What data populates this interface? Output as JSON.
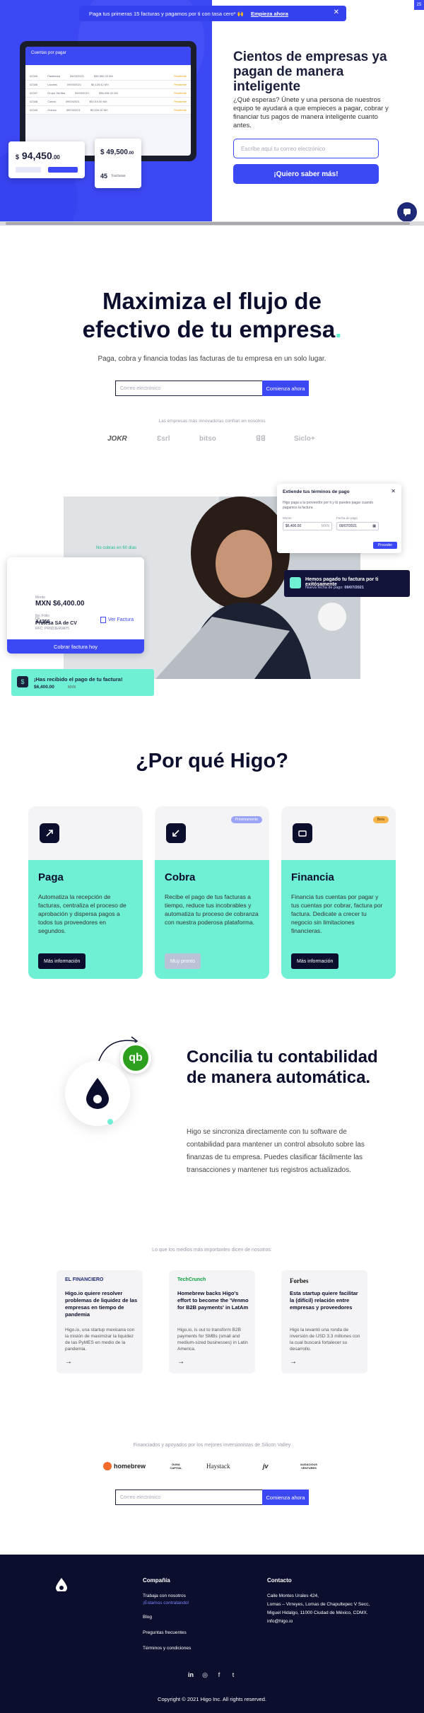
{
  "banner": {
    "text": "Paga tus primeras 15 facturas y pagamos por ti con tasa cero*",
    "emoji": "🙌",
    "cta": "Empieza ahora",
    "close": "✕"
  },
  "hero_mock": {
    "screen_title": "Cuentas por pagar",
    "amount": "94,450",
    "amount_cents": ".00",
    "amount_currency": "$",
    "card_b_amount": "49,500",
    "card_b_cents": ".00",
    "card_b_count": "45",
    "card_b_label": "Facturas",
    "rows": [
      {
        "a": "42345",
        "b": "Pasfetesa",
        "c": "09/03/2021",
        "d": "$35,560.20 MX",
        "s": "Pendiente"
      },
      {
        "a": "42346",
        "b": "Lacobis",
        "c": "09/03/2021",
        "d": "$5,128.42 MX",
        "s": "Pendiente"
      },
      {
        "a": "42347",
        "b": "Grupo Sertiba",
        "c": "09/03/2021",
        "d": "$36,008.32 MX",
        "s": "Pendiente"
      },
      {
        "a": "42348",
        "b": "Cotela",
        "c": "09/03/2021",
        "d": "$5,010.00 MX",
        "s": "Pendiente"
      },
      {
        "a": "42349",
        "b": "Guinso",
        "c": "09/03/2021",
        "d": "$9,000.00 MX",
        "s": "Pendiente"
      }
    ]
  },
  "hero": {
    "title": "Cientos de empresas ya pagan de manera inteligente",
    "text": "¿Qué esperas? Únete y una persona de nuestros equipo te ayudará a que empieces a pagar, cobrar y financiar tus pagos de manera inteligente cuanto antes.",
    "input_placeholder": "Escribe aquí tu correo electrónico",
    "button": "¡Quiero saber más!"
  },
  "main": {
    "title_line1": "Maximiza el flujo de",
    "title_line2": "efectivo de tu empresa",
    "title_dot": ".",
    "subtitle": "Paga, cobra y financia todas las facturas de tu empresa en un solo lugar.",
    "email_placeholder": "Correo electrónico",
    "email_button": "Comienza ahora",
    "trusted_label": "Las empresas más innovadoras confían en nosotros",
    "trusted_logos": [
      "JOKR",
      "Ɛsrl",
      "bitso",
      "ꓭꓭ",
      "Siclo+"
    ]
  },
  "showcase": {
    "pill": "No cobras en 60 días",
    "card_label": "Monto",
    "card_amount": "MXN $6,400.00",
    "de_label": "De",
    "company": "Prutesa SA de CV",
    "company_sub": "RFC: PR6D3ER0AY5",
    "factura_label": "No. Folio",
    "factura_no": "A4256",
    "ver_factura": "Ver Factura",
    "cobrar_btn": "Cobrar factura hoy",
    "toast_title": "¡Has recibido el pago de tu factura!",
    "toast_amount": "$6,400.00",
    "toast_amount_old": "MXN",
    "terms_title": "Extiende tus términos de pago",
    "terms_text": "Higo paga a tu proveedor por ti y tú puedes pagar cuando pagamos la factura",
    "monto_label": "Monto",
    "monto_value": "$6,400.00",
    "monto_curr": "MXN",
    "fecha_label": "Fecha de pago",
    "fecha_value": "09/07/2021",
    "proceder": "Proceder",
    "dark_title": "Hemos pagado tu factura por ti exitósamente",
    "dark_sub": "Nueva fecha de pago:",
    "dark_date": "09/07/2021"
  },
  "why": {
    "title": "¿Por qué Higo?",
    "cards": [
      {
        "title": "Paga",
        "text": "Automatiza la recepción de facturas, centraliza el proceso de aprobación y dispersa pagos a todos tus proveedores en segundos.",
        "button": "Más información",
        "badge": ""
      },
      {
        "title": "Cobra",
        "text": "Recibe el pago de tus facturas a tiempo, reduce tus incobrables y automatiza tu proceso de cobranza con nuestra poderosa plataforma.",
        "button": "Muy pronto",
        "badge": "Próximamente"
      },
      {
        "title": "Financia",
        "text": "Financia tus cuentas por pagar y tus cuentas por cobrar, factura por factura. Dedicate a crecer tu negocio sin limitaciones financieras.",
        "button": "Más información",
        "badge": "Beta"
      }
    ],
    "badge_colors": {
      "proximamente": "#9aa3f5",
      "beta": "#f5b34a"
    }
  },
  "concilia": {
    "title": "Concilia tu contabilidad de manera automática.",
    "text": "Higo se sincroniza directamente con tu software de contabilidad para mantener un control absoluto sobre las finanzas de tu empresa. Puedes clasificar fácilmente las transacciones y mantener tus registros actualizados.",
    "qb_label": "qb"
  },
  "press": {
    "label": "Lo que los medios más importantes dicen de nosotros:",
    "items": [
      {
        "source": "EL FINANCIERO",
        "title": "Higo.io quiere resolver problemas de liquidez de las empresas en tiempo de pandemia",
        "text": "Higo.io, una startup mexicana con la misión de maximizar la liquidez de las PyMES en medio de la pandemia.",
        "arrow": "→"
      },
      {
        "source": "TechCrunch",
        "title": "Homebrew backs Higo's effort to become the 'Venmo for B2B payments' in LatAm",
        "text": "Higo.io, is out to transform B2B payments for SMBs (small and medium-sized businesses) in Latin America.",
        "arrow": "→"
      },
      {
        "source": "Forbes",
        "title": "Esta startup quiere facilitar la (difícil) relación entre empresas y proveedores",
        "text": "Higo la levantó una ronda de inversión de USD 3.3 millones con la cual buscará fortalecer su desarrollo.",
        "arrow": "→"
      }
    ]
  },
  "investors": {
    "label": "Financiados y apoyados por los mejores inversionistas de Silicon Valley",
    "logos": [
      "homebrew",
      "DUNA CAPITAL",
      "Haystack",
      "jv",
      "AUDACIOUS VENTURES"
    ],
    "email_placeholder": "Correo electrónico",
    "email_button": "Comienza ahora"
  },
  "footer": {
    "col1_title": "Compañía",
    "col1_links": [
      "Trabaja con nosotros",
      "¡Estamos contratando!",
      "Blog",
      "Preguntas frecuentes",
      "Términos y condiciones"
    ],
    "col2_title": "Contacto",
    "address": [
      "Calle Montes Urales 424,",
      "Lomas – Virreyes, Lomas de Chapultepec V Secc,",
      "Miguel Hidalgo, 11000 Ciudad de México, CDMX."
    ],
    "email": "info@higo.io",
    "social": [
      "in",
      "◎",
      "f",
      "t"
    ],
    "copyright": "Copyright © 2021 Higo Inc. All rights reserved."
  }
}
